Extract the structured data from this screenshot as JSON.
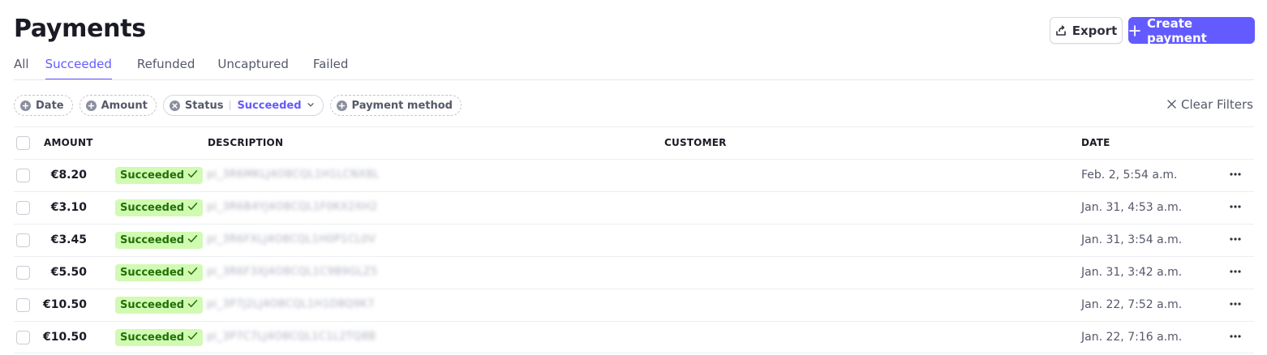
{
  "page": {
    "title": "Payments"
  },
  "header_actions": {
    "export_label": "Export",
    "create_label": "Create payment"
  },
  "tabs": [
    {
      "label": "All",
      "active": false
    },
    {
      "label": "Succeeded",
      "active": true
    },
    {
      "label": "Refunded",
      "active": false
    },
    {
      "label": "Uncaptured",
      "active": false
    },
    {
      "label": "Failed",
      "active": false
    }
  ],
  "filters": {
    "date_label": "Date",
    "amount_label": "Amount",
    "status_label": "Status",
    "status_value": "Succeeded",
    "payment_method_label": "Payment method",
    "clear_label": "Clear Filters"
  },
  "table": {
    "columns": {
      "amount": "AMOUNT",
      "description": "DESCRIPTION",
      "customer": "CUSTOMER",
      "date": "DATE"
    },
    "rows": [
      {
        "amount": "€8.20",
        "status": "Succeeded",
        "description": "pi_3R6MKLJ4O8CQL1H1LCNX8L",
        "customer": "",
        "date": "Feb. 2, 5:54 a.m."
      },
      {
        "amount": "€3.10",
        "status": "Succeeded",
        "description": "pi_3R6B4YJ4O8CQL1F0KX2XH2",
        "customer": "",
        "date": "Jan. 31, 4:53 a.m."
      },
      {
        "amount": "€3.45",
        "status": "Succeeded",
        "description": "pi_3R6FXLJ4O8CQL1H0P1CL0V",
        "customer": "",
        "date": "Jan. 31, 3:54 a.m."
      },
      {
        "amount": "€5.50",
        "status": "Succeeded",
        "description": "pi_3R6F3XJ4O8CQL1C9B9GLZ5",
        "customer": "",
        "date": "Jan. 31, 3:42 a.m."
      },
      {
        "amount": "€10.50",
        "status": "Succeeded",
        "description": "pi_3P7J2LJ4O8CQL1H1D8Q9K7",
        "customer": "",
        "date": "Jan. 22, 7:52 a.m."
      },
      {
        "amount": "€10.50",
        "status": "Succeeded",
        "description": "pi_3P7C7LJ4O8CQL1C1L2TQ8B",
        "customer": "",
        "date": "Jan. 22, 7:16 a.m."
      }
    ]
  },
  "icons": {
    "export": "export-icon",
    "plus": "plus-icon",
    "add_filter": "plus-circle-icon",
    "remove_filter": "x-circle-icon",
    "chevron": "chevron-down-icon",
    "clear": "close-icon",
    "check": "check-icon",
    "more": "more-horizontal-icon"
  },
  "colors": {
    "accent": "#635bff",
    "success_bg": "#d1fab3",
    "success_text": "#217005"
  }
}
